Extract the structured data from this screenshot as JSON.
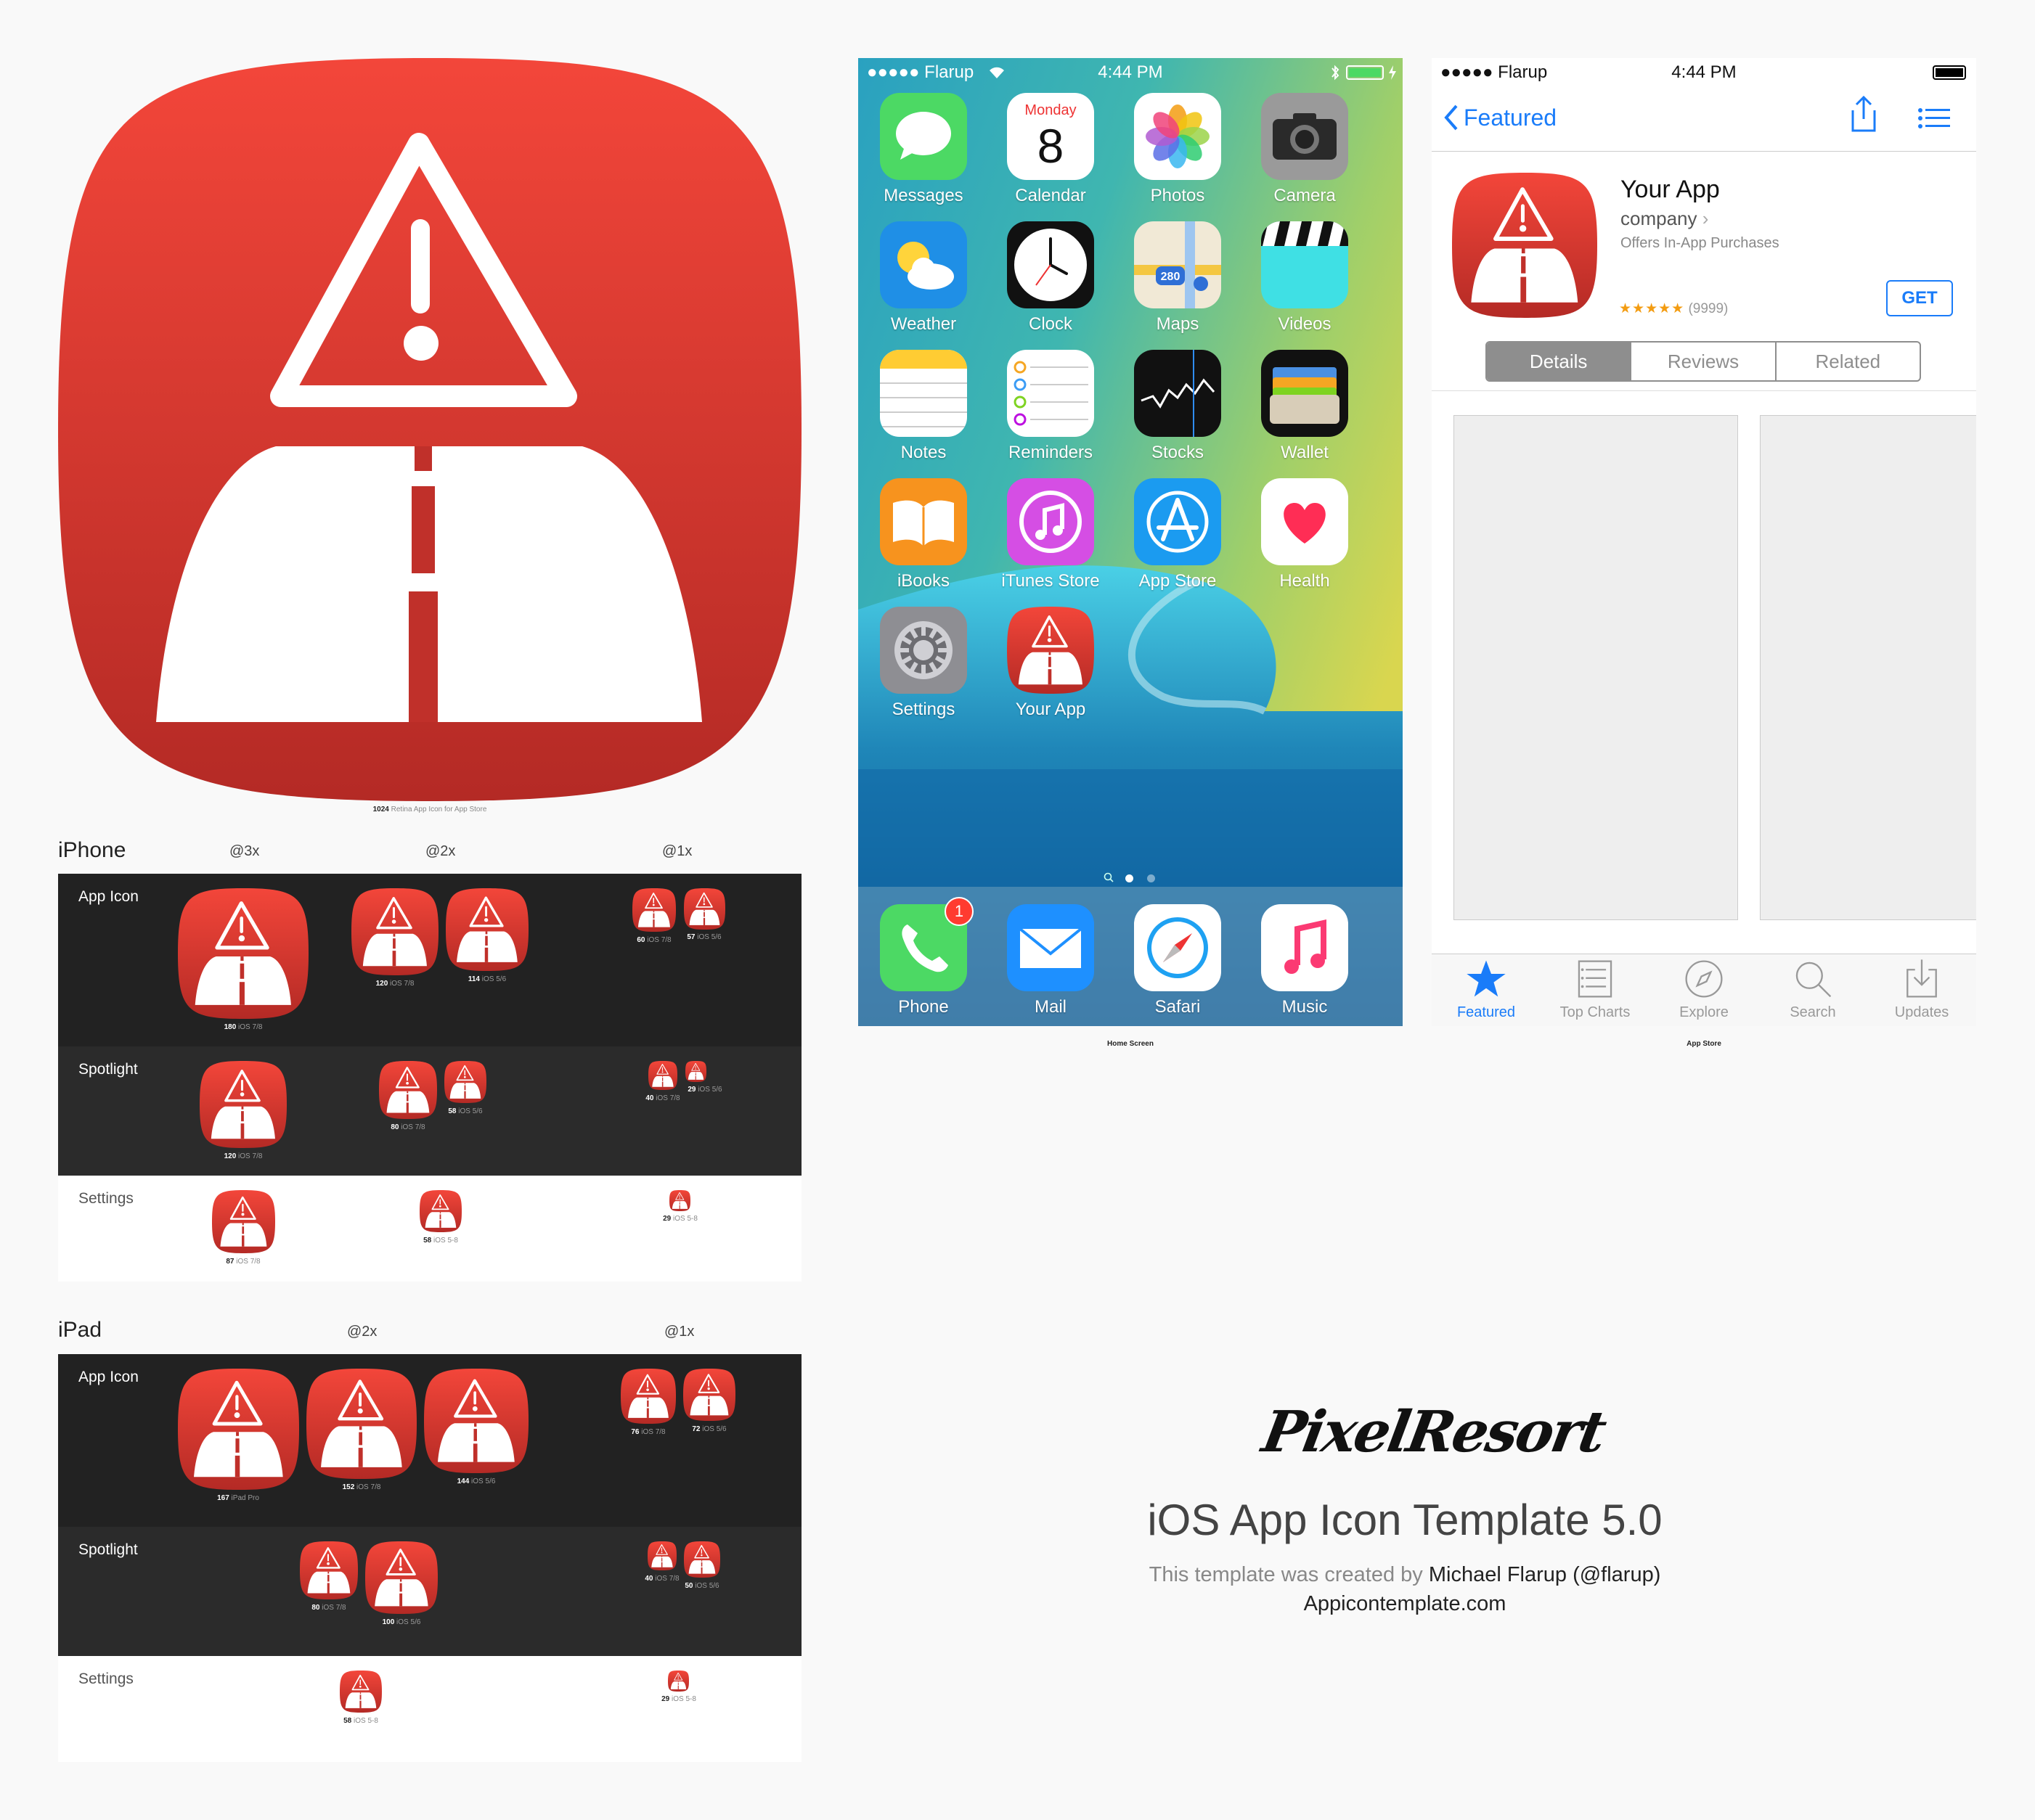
{
  "big_icon": {
    "caption_strong": "1024",
    "caption": "Retina App Icon for App Store"
  },
  "iphone": {
    "title": "iPhone",
    "col_headers": [
      "@3x",
      "@2x",
      "@1x"
    ],
    "rows": [
      {
        "label": "App Icon",
        "icons": [
          {
            "strong": "180",
            "text": "iOS 7/8"
          },
          {
            "strong": "120",
            "text": "iOS 7/8"
          },
          {
            "strong": "114",
            "text": "iOS 5/6"
          },
          {
            "strong": "60",
            "text": "iOS 7/8"
          },
          {
            "strong": "57",
            "text": "iOS 5/6"
          }
        ]
      },
      {
        "label": "Spotlight",
        "icons": [
          {
            "strong": "120",
            "text": "iOS 7/8"
          },
          {
            "strong": "80",
            "text": "iOS 7/8"
          },
          {
            "strong": "58",
            "text": "iOS 5/6"
          },
          {
            "strong": "40",
            "text": "iOS 7/8"
          },
          {
            "strong": "29",
            "text": "iOS 5/6"
          }
        ]
      },
      {
        "label": "Settings",
        "icons": [
          {
            "strong": "87",
            "text": "iOS 7/8"
          },
          {
            "strong": "58",
            "text": "iOS 5-8"
          },
          {
            "strong": "29",
            "text": "iOS 5-8"
          }
        ]
      }
    ]
  },
  "ipad": {
    "title": "iPad",
    "col_headers": [
      "@2x",
      "@1x"
    ],
    "rows": [
      {
        "label": "App Icon",
        "icons": [
          {
            "strong": "167",
            "text": "iPad Pro"
          },
          {
            "strong": "152",
            "text": "iOS 7/8"
          },
          {
            "strong": "144",
            "text": "iOS 5/6"
          },
          {
            "strong": "76",
            "text": "iOS 7/8"
          },
          {
            "strong": "72",
            "text": "iOS 5/6"
          }
        ]
      },
      {
        "label": "Spotlight",
        "icons": [
          {
            "strong": "80",
            "text": "iOS 7/8"
          },
          {
            "strong": "100",
            "text": "iOS 5/6"
          },
          {
            "strong": "40",
            "text": "iOS 7/8"
          },
          {
            "strong": "50",
            "text": "iOS 5/6"
          }
        ]
      },
      {
        "label": "Settings",
        "icons": [
          {
            "strong": "58",
            "text": "iOS 5-8"
          },
          {
            "strong": "29",
            "text": "iOS 5-8"
          }
        ]
      }
    ]
  },
  "home_screen": {
    "caption": "Home Screen",
    "status": {
      "carrier": "Flarup",
      "time": "4:44 PM"
    },
    "calendar": {
      "weekday": "Monday",
      "day": "8"
    },
    "apps": [
      {
        "name": "Messages",
        "icon": "messages-icon"
      },
      {
        "name": "Calendar",
        "icon": "calendar-icon"
      },
      {
        "name": "Photos",
        "icon": "photos-icon"
      },
      {
        "name": "Camera",
        "icon": "camera-icon"
      },
      {
        "name": "Weather",
        "icon": "weather-icon"
      },
      {
        "name": "Clock",
        "icon": "clock-icon"
      },
      {
        "name": "Maps",
        "icon": "maps-icon"
      },
      {
        "name": "Videos",
        "icon": "videos-icon"
      },
      {
        "name": "Notes",
        "icon": "notes-icon"
      },
      {
        "name": "Reminders",
        "icon": "reminders-icon"
      },
      {
        "name": "Stocks",
        "icon": "stocks-icon"
      },
      {
        "name": "Wallet",
        "icon": "wallet-icon"
      },
      {
        "name": "iBooks",
        "icon": "ibooks-icon"
      },
      {
        "name": "iTunes Store",
        "icon": "itunes-store-icon"
      },
      {
        "name": "App Store",
        "icon": "app-store-icon"
      },
      {
        "name": "Health",
        "icon": "health-icon"
      },
      {
        "name": "Settings",
        "icon": "settings-icon"
      },
      {
        "name": "Your App",
        "icon": "your-app-icon"
      }
    ],
    "maps_shield": "280",
    "dock": [
      {
        "name": "Phone",
        "icon": "phone-icon",
        "badge": "1"
      },
      {
        "name": "Mail",
        "icon": "mail-icon"
      },
      {
        "name": "Safari",
        "icon": "safari-icon"
      },
      {
        "name": "Music",
        "icon": "music-icon"
      }
    ]
  },
  "app_store": {
    "caption": "App Store",
    "status": {
      "carrier": "Flarup",
      "time": "4:44 PM"
    },
    "back_label": "Featured",
    "app_name": "Your App",
    "company": "company",
    "iap_note": "Offers In-App Purchases",
    "stars": "★★★★★",
    "rating_count": "(9999)",
    "get_label": "GET",
    "segments": [
      "Details",
      "Reviews",
      "Related"
    ],
    "tabs": [
      {
        "label": "Featured",
        "icon": "star-icon"
      },
      {
        "label": "Top Charts",
        "icon": "list-icon"
      },
      {
        "label": "Explore",
        "icon": "compass-icon"
      },
      {
        "label": "Search",
        "icon": "search-icon"
      },
      {
        "label": "Updates",
        "icon": "download-icon"
      }
    ]
  },
  "credits": {
    "logo": "PixelResort",
    "title": "iOS App Icon Template 5.0",
    "created_prefix": "This template was created by ",
    "author": "Michael Flarup (@flarup)",
    "site": "Appicontemplate.com"
  },
  "colors": {
    "icon_top": "#f3463a",
    "icon_bottom": "#b42a25",
    "accent": "#1a7cf9",
    "dark_row": "#222222",
    "dark_row_alt": "#2b2b2b"
  }
}
